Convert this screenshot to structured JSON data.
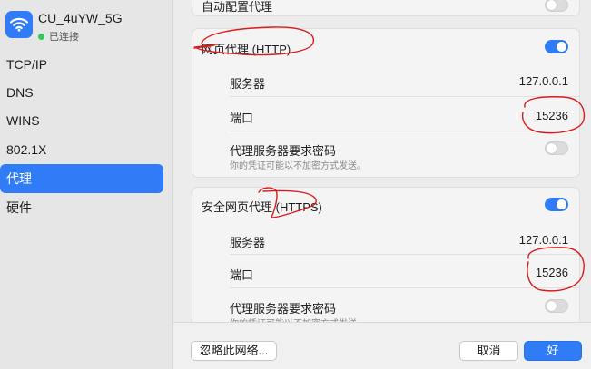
{
  "network": {
    "name": "CU_4uYW_5G",
    "status": "已连接",
    "status_color": "#34c759",
    "icon": "wifi-icon"
  },
  "sidebar": {
    "items": [
      {
        "label": "TCP/IP",
        "active": false
      },
      {
        "label": "DNS",
        "active": false
      },
      {
        "label": "WINS",
        "active": false
      },
      {
        "label": "802.1X",
        "active": false
      },
      {
        "label": "代理",
        "active": true
      },
      {
        "label": "硬件",
        "active": false
      }
    ]
  },
  "auto_proxy": {
    "label": "自动配置代理",
    "enabled": false
  },
  "http_proxy": {
    "title": "网页代理 (HTTP)",
    "enabled": true,
    "server_label": "服务器",
    "server_value": "127.0.0.1",
    "port_label": "端口",
    "port_value": "15236",
    "auth_label": "代理服务器要求密码",
    "auth_hint": "你的凭证可能以不加密方式发送。",
    "auth_enabled": false
  },
  "https_proxy": {
    "title": "安全网页代理 (HTTPS)",
    "enabled": true,
    "server_label": "服务器",
    "server_value": "127.0.0.1",
    "port_label": "端口",
    "port_value": "15236",
    "auth_label": "代理服务器要求密码",
    "auth_hint": "你的凭证可能以不加密方式发送。",
    "auth_enabled": false
  },
  "footer": {
    "ignore_label": "忽略此网络...",
    "cancel_label": "取消",
    "ok_label": "好"
  },
  "colors": {
    "accent": "#2f7cf6",
    "annotation": "#d81c1c"
  }
}
